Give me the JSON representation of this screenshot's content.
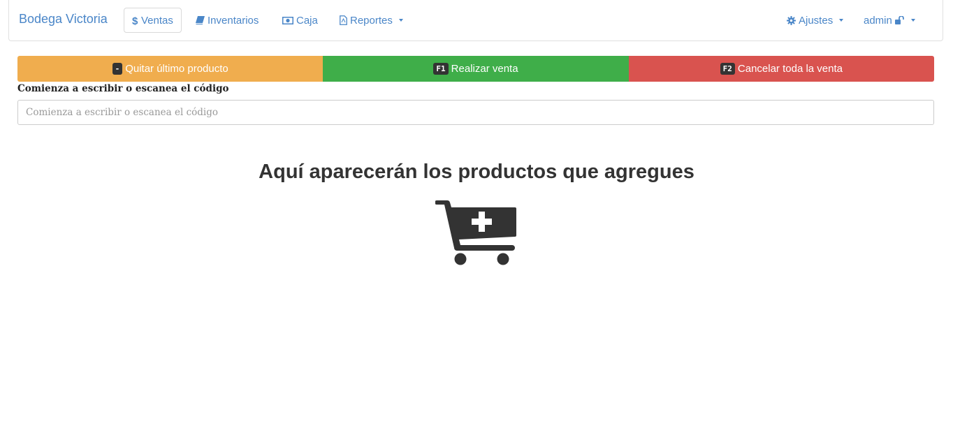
{
  "navbar": {
    "brand": "Bodega Victoria",
    "items": [
      {
        "label": "Ventas",
        "icon": "dollar-icon",
        "active": true
      },
      {
        "label": "Inventarios",
        "icon": "book-icon"
      },
      {
        "label": "Caja",
        "icon": "money-icon"
      },
      {
        "label": "Reportes",
        "icon": "file-pdf-icon",
        "dropdown": true
      }
    ],
    "right": [
      {
        "label": "Ajustes",
        "icon": "gear-icon",
        "dropdown": true
      },
      {
        "label": "admin",
        "icon": "unlock-icon",
        "dropdown": true
      }
    ]
  },
  "actions": [
    {
      "key": "-",
      "label": "Quitar último producto",
      "color": "#f0ad4e"
    },
    {
      "key": "F1",
      "label": "Realizar venta",
      "color": "#3fae49"
    },
    {
      "key": "F2",
      "label": "Cancelar toda la venta",
      "color": "#d9534f"
    }
  ],
  "search": {
    "label": "Comienza a escribir o escanea el código",
    "placeholder": "Comienza a escribir o escanea el código",
    "value": ""
  },
  "empty_state": {
    "title": "Aquí aparecerán los productos que agregues",
    "icon": "cart-plus-icon"
  },
  "colors": {
    "link": "#4a86c8",
    "text": "#333333"
  }
}
